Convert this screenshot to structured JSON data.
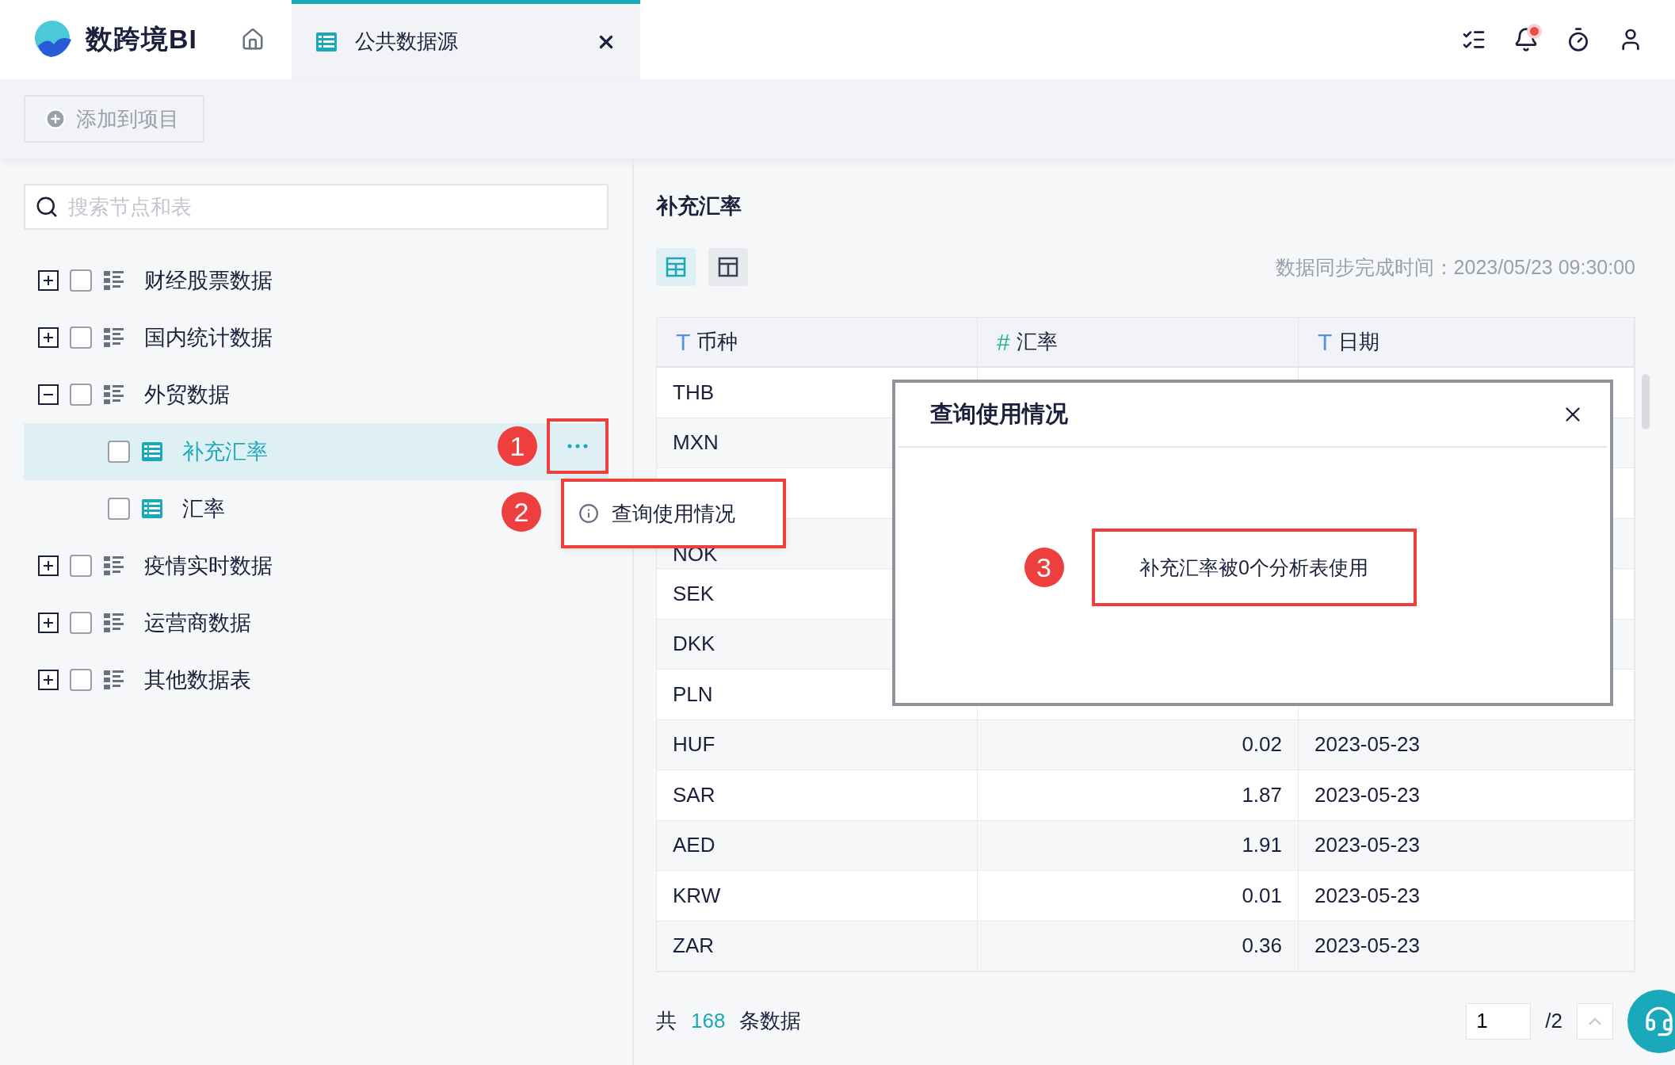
{
  "header": {
    "logo_text": "数跨境BI",
    "tabs": [
      {
        "label": "公共数据源",
        "selected": true
      }
    ],
    "bell": {
      "unread": true
    }
  },
  "toolbar": {
    "add_button": "添加到项目"
  },
  "search": {
    "placeholder": "搜索节点和表"
  },
  "tree": [
    {
      "label": "财经股票数据",
      "kind": "folder",
      "expanded": false,
      "checked": false,
      "selected": false
    },
    {
      "label": "国内统计数据",
      "kind": "folder",
      "expanded": false,
      "checked": false,
      "selected": false
    },
    {
      "label": "外贸数据",
      "kind": "folder",
      "expanded": true,
      "checked": false,
      "selected": false,
      "children": [
        {
          "label": "补充汇率",
          "kind": "table",
          "checked": false,
          "selected": true,
          "annotation": "1"
        },
        {
          "label": "汇率",
          "kind": "table",
          "checked": false,
          "selected": false
        }
      ]
    },
    {
      "label": "疫情实时数据",
      "kind": "folder",
      "expanded": false,
      "checked": false,
      "selected": false
    },
    {
      "label": "运营商数据",
      "kind": "folder",
      "expanded": false,
      "checked": false,
      "selected": false
    },
    {
      "label": "其他数据表",
      "kind": "folder",
      "expanded": false,
      "checked": false,
      "selected": false
    }
  ],
  "detail": {
    "title": "补充汇率",
    "view_toggles": [
      {
        "selected": true
      },
      {
        "selected": false
      }
    ],
    "sync_time": "数据同步完成时间：2023/05/23 09:30:00",
    "columns": [
      {
        "type_mark": "T",
        "label": "币种",
        "kind": "text"
      },
      {
        "type_mark": "#",
        "label": "汇率",
        "kind": "number"
      },
      {
        "type_mark": "T",
        "label": "日期",
        "kind": "text"
      }
    ],
    "rows": [
      {
        "cells": [
          "THB"
        ]
      },
      {
        "cells": [
          "MXN"
        ]
      },
      {},
      {
        "cells": [
          "NOK"
        ]
      },
      {
        "cells": [
          "SEK"
        ]
      },
      {
        "cells": [
          "DKK"
        ]
      },
      {
        "cells": [
          "PLN"
        ]
      },
      {
        "cells": [
          "HUF",
          "0.02",
          "2023-05-23"
        ]
      },
      {
        "cells": [
          "SAR",
          "1.87",
          "2023-05-23"
        ]
      },
      {
        "cells": [
          "AED",
          "1.91",
          "2023-05-23"
        ]
      },
      {
        "cells": [
          "KRW",
          "0.01",
          "2023-05-23"
        ]
      },
      {
        "cells": [
          "ZAR",
          "0.36",
          "2023-05-23"
        ]
      }
    ],
    "footer": {
      "prefix": "共",
      "count": "168",
      "suffix": "条数据",
      "page": "1",
      "total_pages": "/2"
    }
  },
  "context_menu": {
    "annotation": "2",
    "items": [
      {
        "label": "查询使用情况"
      }
    ]
  },
  "dialog": {
    "title": "查询使用情况",
    "message": "补充汇率被0个分析表使用",
    "annotation": "3"
  }
}
